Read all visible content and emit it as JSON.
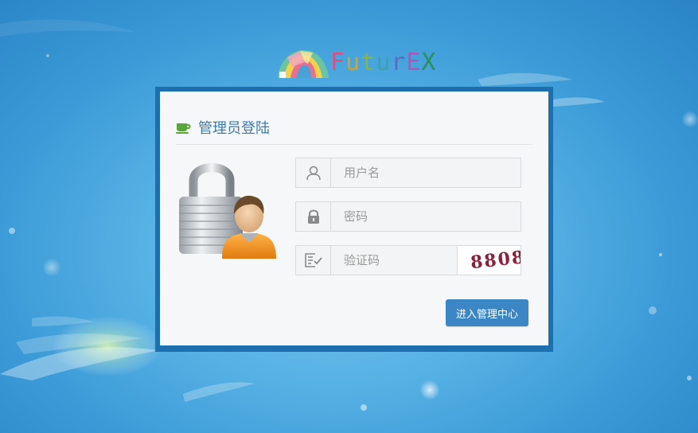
{
  "brand": {
    "logo_text": "FuturEX",
    "logo_letters": [
      "F",
      "u",
      "t",
      "u",
      "r",
      "E",
      "X"
    ]
  },
  "login": {
    "title": "管理员登陆",
    "username_placeholder": "用户名",
    "password_placeholder": "密码",
    "captcha_placeholder": "验证码",
    "captcha_text": "8808",
    "submit_label": "进入管理中心"
  },
  "icons": {
    "title_icon": "coffee-cup-icon",
    "username_icon": "user-icon",
    "password_icon": "lock-icon",
    "captcha_icon": "checklist-icon",
    "illustration": "padlock-user-illustration"
  },
  "colors": {
    "background": "#56b1e4",
    "frame": "#1e6fae",
    "panel": "#f6f7f8",
    "title": "#3a7ab3",
    "button": "#3d86c6",
    "captcha_text": "#8c1f3a"
  }
}
